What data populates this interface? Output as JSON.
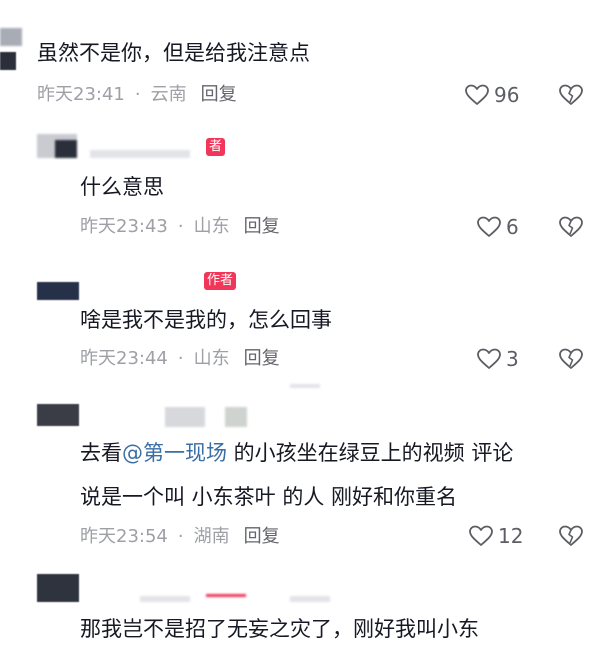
{
  "comments": [
    {
      "text": "虽然不是你，但是给我注意点",
      "time": "昨天23:41",
      "location": "云南",
      "reply_label": "回复",
      "likes": "96"
    },
    {
      "badge": "者",
      "text": "什么意思",
      "time": "昨天23:43",
      "location": "山东",
      "reply_label": "回复",
      "likes": "6"
    },
    {
      "badge": "作者",
      "text": "啥是我不是我的，怎么回事",
      "time": "昨天23:44",
      "location": "山东",
      "reply_label": "回复",
      "likes": "3"
    },
    {
      "text_prefix": "去看",
      "mention": "@第一现场",
      "text_line1_suffix": " 的小孩坐在绿豆上的视频 评论",
      "text_line2": "说是一个叫 小东茶叶 的人 刚好和你重名",
      "time": "昨天23:54",
      "location": "湖南",
      "reply_label": "回复",
      "likes": "12"
    },
    {
      "text": "那我岂不是招了无妄之灾了，刚好我叫小东"
    }
  ],
  "meta_separator": "·",
  "icons": {
    "like": "heart-outline-icon",
    "dislike": "broken-heart-icon"
  },
  "colors": {
    "author_badge": "#f0375a",
    "mention": "#3a6ea5"
  }
}
